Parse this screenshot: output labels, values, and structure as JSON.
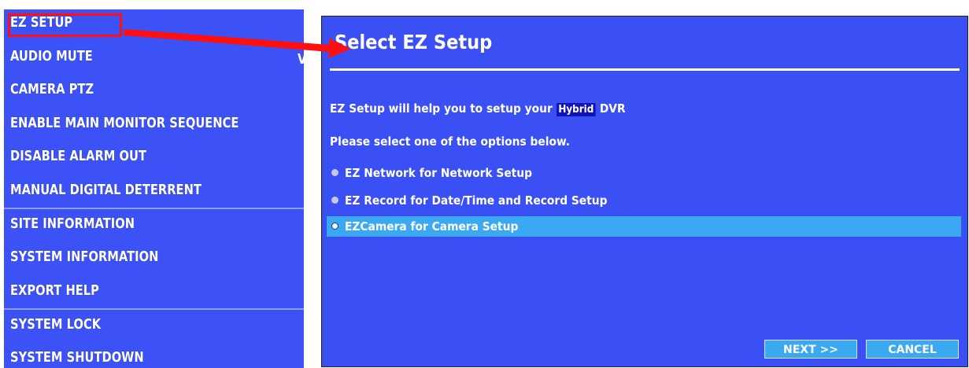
{
  "menu": {
    "items": [
      {
        "label": "EZ SETUP"
      },
      {
        "label": "AUDIO MUTE"
      },
      {
        "label": "CAMERA PTZ"
      },
      {
        "label": "ENABLE MAIN MONITOR SEQUENCE"
      },
      {
        "label": "DISABLE ALARM OUT"
      },
      {
        "label": "MANUAL DIGITAL DETERRENT"
      },
      {
        "label": "SITE INFORMATION"
      },
      {
        "label": "SYSTEM INFORMATION"
      },
      {
        "label": "EXPORT HELP"
      },
      {
        "label": "SYSTEM LOCK"
      },
      {
        "label": "SYSTEM SHUTDOWN"
      }
    ],
    "audio_mute_indicator": "V"
  },
  "dialog": {
    "title": "Select EZ Setup",
    "intro_prefix": "EZ Setup will help you to setup your",
    "intro_highlight": "Hybrid",
    "intro_suffix": "DVR",
    "instruction": "Please select one of the options below.",
    "options": [
      {
        "label": "EZ Network for Network Setup",
        "selected": false
      },
      {
        "label": "EZ Record for Date/Time and Record Setup",
        "selected": false
      },
      {
        "label": "EZCamera for Camera Setup",
        "selected": true
      }
    ],
    "next_label": "NEXT >>",
    "cancel_label": "CANCEL"
  },
  "colors": {
    "panel_blue": "#3c52f6",
    "selection_blue": "#3aa9f2",
    "annotation_red": "#ff1010"
  }
}
